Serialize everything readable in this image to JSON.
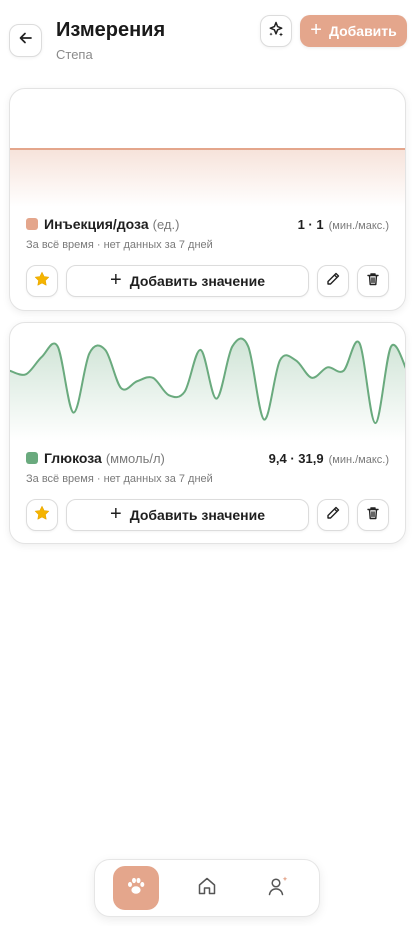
{
  "header": {
    "title": "Измерения",
    "subtitle": "Степа",
    "add_label": "Добавить",
    "back_icon": "arrow-left-icon",
    "spark_icon": "sparkles-icon"
  },
  "metrics": [
    {
      "name": "Инъекция/доза",
      "unit": "(ед.)",
      "range_value": "1 · 1",
      "range_label": "(мин./макс.)",
      "meta": "За всё время · нет данных за 7 дней",
      "add_value_label": "Добавить значение",
      "color": "#e4a68c"
    },
    {
      "name": "Глюкоза",
      "unit": "(ммоль/л)",
      "range_value": "9,4 · 31,9",
      "range_label": "(мин./макс.)",
      "meta": "За всё время · нет данных за 7 дней",
      "add_value_label": "Добавить значение",
      "color": "#6aaa7e"
    }
  ],
  "chart_data": [
    {
      "type": "line",
      "series": [
        {
          "values": [
            1,
            1
          ]
        }
      ],
      "ylim": [
        0,
        2
      ],
      "color": "#e4a68c",
      "grid": false
    },
    {
      "type": "area",
      "series": [
        {
          "values": [
            24,
            23,
            28,
            31,
            12,
            29,
            30,
            19,
            21,
            22,
            17,
            18,
            30,
            16,
            31,
            31,
            10,
            27,
            27,
            22,
            25,
            24,
            32,
            9,
            31,
            24
          ]
        }
      ],
      "ylim": [
        5,
        36
      ],
      "color": "#6aaa7e",
      "grid": false
    }
  ],
  "nav": {
    "items": [
      {
        "icon": "paw-icon",
        "active": true
      },
      {
        "icon": "home-icon",
        "active": false
      },
      {
        "icon": "user-sparkle-icon",
        "active": false
      }
    ]
  }
}
